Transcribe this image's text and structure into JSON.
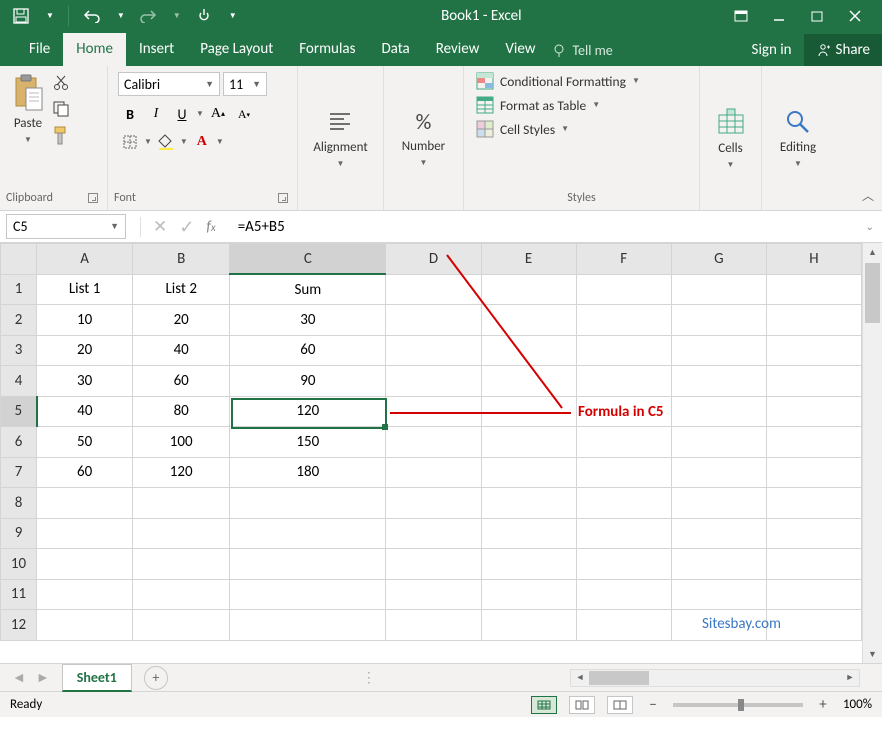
{
  "window": {
    "title": "Book1 - Excel"
  },
  "tabs": {
    "file": "File",
    "home": "Home",
    "insert": "Insert",
    "pagelayout": "Page Layout",
    "formulas": "Formulas",
    "data": "Data",
    "review": "Review",
    "view": "View",
    "tellme": "Tell me",
    "signin": "Sign in",
    "share": "Share"
  },
  "ribbon": {
    "clipboard": {
      "label": "Clipboard",
      "paste": "Paste"
    },
    "font": {
      "label": "Font",
      "name": "Calibri",
      "size": "11"
    },
    "alignment": {
      "label": "Alignment"
    },
    "number": {
      "label": "Number"
    },
    "styles": {
      "label": "Styles",
      "conditional": "Conditional Formatting",
      "formatTable": "Format as Table",
      "cellStyles": "Cell Styles"
    },
    "cells": {
      "label": "Cells"
    },
    "editing": {
      "label": "Editing"
    }
  },
  "formulaBar": {
    "nameBox": "C5",
    "formula": "=A5+B5"
  },
  "grid": {
    "columns": [
      "A",
      "B",
      "C",
      "D",
      "E",
      "F",
      "G",
      "H"
    ],
    "rows": [
      {
        "n": "1",
        "cells": [
          "List 1",
          "List 2",
          "Sum",
          "",
          "",
          "",
          "",
          ""
        ]
      },
      {
        "n": "2",
        "cells": [
          "10",
          "20",
          "30",
          "",
          "",
          "",
          "",
          ""
        ]
      },
      {
        "n": "3",
        "cells": [
          "20",
          "40",
          "60",
          "",
          "",
          "",
          "",
          ""
        ]
      },
      {
        "n": "4",
        "cells": [
          "30",
          "60",
          "90",
          "",
          "",
          "",
          "",
          ""
        ]
      },
      {
        "n": "5",
        "cells": [
          "40",
          "80",
          "120",
          "",
          "",
          "",
          "",
          ""
        ]
      },
      {
        "n": "6",
        "cells": [
          "50",
          "100",
          "150",
          "",
          "",
          "",
          "",
          ""
        ]
      },
      {
        "n": "7",
        "cells": [
          "60",
          "120",
          "180",
          "",
          "",
          "",
          "",
          ""
        ]
      },
      {
        "n": "8",
        "cells": [
          "",
          "",
          "",
          "",
          "",
          "",
          "",
          ""
        ]
      },
      {
        "n": "9",
        "cells": [
          "",
          "",
          "",
          "",
          "",
          "",
          "",
          ""
        ]
      },
      {
        "n": "10",
        "cells": [
          "",
          "",
          "",
          "",
          "",
          "",
          "",
          ""
        ]
      },
      {
        "n": "11",
        "cells": [
          "",
          "",
          "",
          "",
          "",
          "",
          "",
          ""
        ]
      },
      {
        "n": "12",
        "cells": [
          "",
          "",
          "",
          "",
          "",
          "",
          "",
          ""
        ]
      }
    ],
    "selected": {
      "row": 5,
      "col": "C"
    }
  },
  "annotation": {
    "text": "Formula in C5"
  },
  "watermark": "Sitesbay.com",
  "sheetTabs": {
    "active": "Sheet1"
  },
  "status": {
    "ready": "Ready",
    "zoom": "100%"
  }
}
